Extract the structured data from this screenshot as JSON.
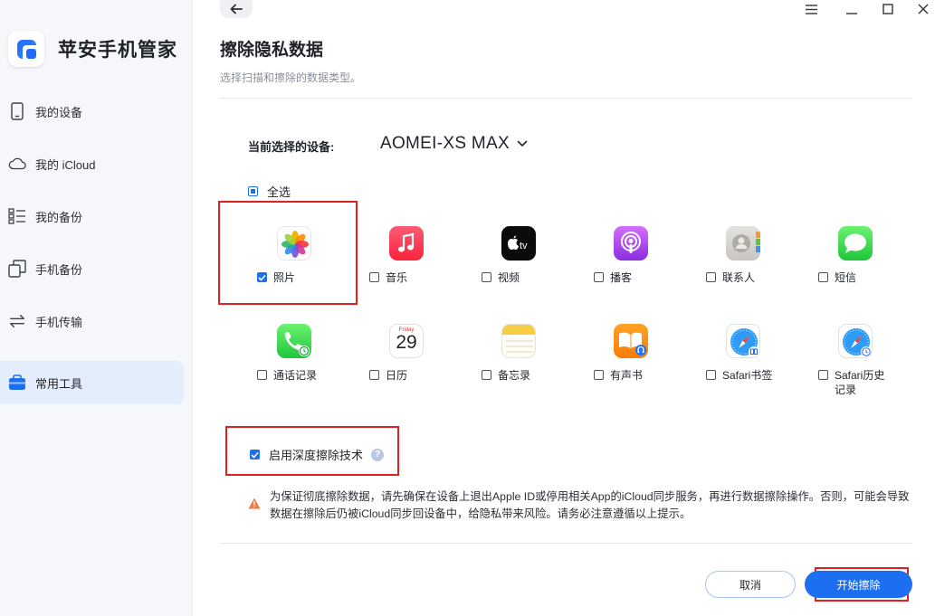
{
  "app": {
    "name": "苹安手机管家"
  },
  "sidebar": {
    "items": [
      {
        "label": "我的设备",
        "icon": "phone-icon"
      },
      {
        "label": "我的 iCloud",
        "icon": "cloud-icon"
      },
      {
        "label": "我的备份",
        "icon": "backup-list-icon"
      },
      {
        "label": "手机备份",
        "icon": "copy-icon"
      },
      {
        "label": "手机传输",
        "icon": "transfer-icon"
      },
      {
        "label": "常用工具",
        "icon": "toolbox-icon",
        "active": true
      }
    ]
  },
  "header": {
    "title": "擦除隐私数据",
    "subtitle": "选择扫描和擦除的数据类型。"
  },
  "device": {
    "label": "当前选择的设备:",
    "name": "AOMEI-XS MAX"
  },
  "select_all": {
    "label": "全选",
    "state": "partial"
  },
  "categories": [
    {
      "name": "照片",
      "checked": true,
      "icon": "photos-icon"
    },
    {
      "name": "音乐",
      "checked": false,
      "icon": "music-icon"
    },
    {
      "name": "视频",
      "checked": false,
      "icon": "apple-tv-icon"
    },
    {
      "name": "播客",
      "checked": false,
      "icon": "podcasts-icon"
    },
    {
      "name": "联系人",
      "checked": false,
      "icon": "contacts-icon"
    },
    {
      "name": "短信",
      "checked": false,
      "icon": "messages-icon"
    },
    {
      "name": "通话记录",
      "checked": false,
      "icon": "phone-call-icon"
    },
    {
      "name": "日历",
      "checked": false,
      "icon": "calendar-icon"
    },
    {
      "name": "备忘录",
      "checked": false,
      "icon": "notes-icon"
    },
    {
      "name": "有声书",
      "checked": false,
      "icon": "audiobooks-icon"
    },
    {
      "name": "Safari书签",
      "checked": false,
      "icon": "safari-bookmark-icon"
    },
    {
      "name": "Safari历史记录",
      "checked": false,
      "icon": "safari-history-icon"
    }
  ],
  "calendar_icon": {
    "weekday": "Friday",
    "day": "29"
  },
  "deep_erase": {
    "label": "启用深度擦除技术",
    "checked": true,
    "help": "?"
  },
  "warning": {
    "text": "为保证彻底擦除数据，请先确保在设备上退出Apple ID或停用相关App的iCloud同步服务，再进行数据擦除操作。否则，可能会导致数据在擦除后仍被iCloud同步回设备中，给隐私带来风险。请务必注意遵循以上提示。"
  },
  "buttons": {
    "cancel": "取消",
    "start": "开始擦除"
  },
  "colors": {
    "accent": "#1d6ff2",
    "highlight": "#e02020",
    "warning": "#f5793b"
  }
}
